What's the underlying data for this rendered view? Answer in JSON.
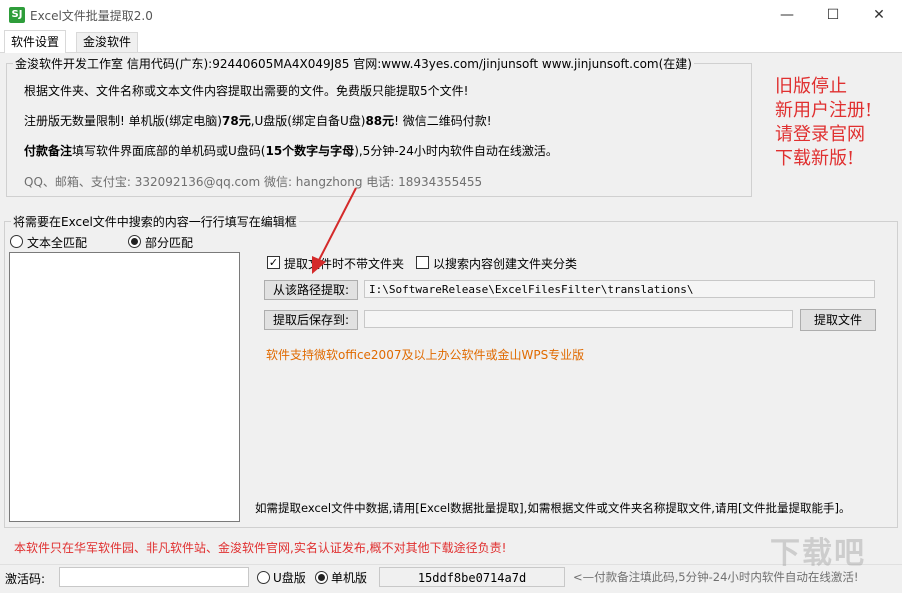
{
  "window": {
    "app_icon_text": "SJ",
    "title": "Excel文件批量提取2.0"
  },
  "tabs": [
    {
      "label": "软件设置"
    },
    {
      "label": "金浚软件"
    }
  ],
  "info": {
    "legend": "金浚软件开发工作室 信用代码(广东):92440605MA4X049J85 官网:www.43yes.com/jinjunsoft  www.jinjunsoft.com(在建)",
    "line1": "根据文件夹、文件名称或文本文件内容提取出需要的文件。免费版只能提取5个文件!",
    "line2_a": "注册版无数量限制! 单机版(绑定电脑)",
    "line2_b": "78元",
    "line2_c": ",U盘版(绑定自备U盘)",
    "line2_d": "88元",
    "line2_e": "! 微信二维码付款!",
    "line3_a": "付款备注",
    "line3_b": "填写软件界面底部的单机码或U盘码(",
    "line3_c": "15个数字与字母",
    "line3_d": "),5分钟-24小时内软件自动在线激活。",
    "contact": "QQ、邮箱、支付宝: 332092136@qq.com   微信: hangzhong   电话: 18934355455"
  },
  "notice": {
    "lines": [
      "旧版停止",
      "新用户注册!",
      "请登录官网",
      "下载新版!"
    ],
    "color": "#e03030"
  },
  "search": {
    "legend": "将需要在Excel文件中搜索的内容一行行填写在编辑框",
    "radio_full": "文本全匹配",
    "radio_partial": "部分匹配",
    "selected": "部分匹配"
  },
  "options": {
    "check1_label": "提取文件时不带文件夹",
    "check1_checked": true,
    "check2_label": "以搜索内容创建文件夹分类",
    "check2_checked": false
  },
  "paths": {
    "source_button": "从该路径提取:",
    "source_value": "I:\\SoftwareRelease\\ExcelFilesFilter\\translations\\",
    "dest_button": "提取后保存到:",
    "dest_value": "",
    "extract_button": "提取文件"
  },
  "support_text": "软件支持微软office2007及以上办公软件或金山WPS专业版",
  "hint_text": "如需提取excel文件中数据,请用[Excel数据批量提取],如需根据文件或文件夹名称提取文件,请用[文件批量提取能手]。",
  "warning_text": "本软件只在华军软件园、非凡软件站、金浚软件官网,实名认证发布,概不对其他下载途径负责!",
  "status": {
    "activation_label": "激活码:",
    "activation_value": "",
    "radio_usb": "U盘版",
    "radio_single": "单机版",
    "selected": "单机版",
    "machine_code": "15ddf8be0714a7d",
    "tip": "<—付款备注填此码,5分钟-24小时内软件自动在线激活!"
  },
  "watermark": "下载吧",
  "colors": {
    "red": "#e03030",
    "orange": "#e06a00",
    "arrow": "#d42a2a"
  }
}
